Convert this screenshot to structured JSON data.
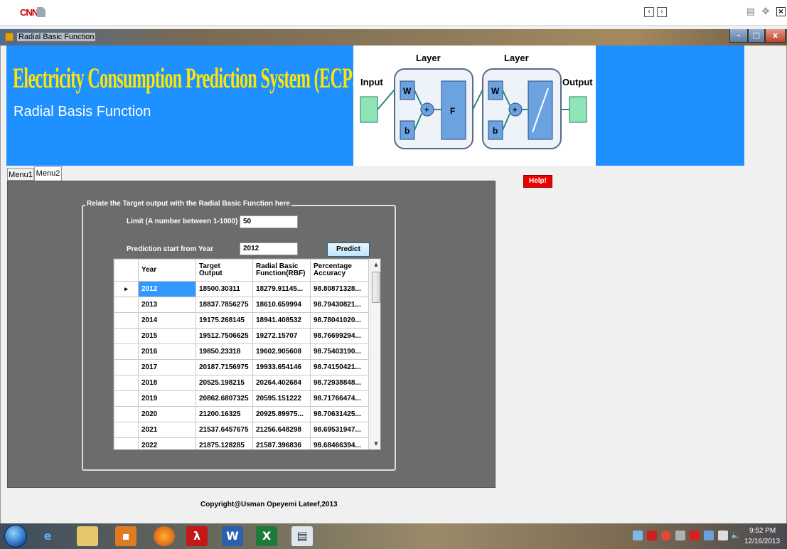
{
  "browser": {
    "logo_text": "CNN",
    "prev_glyph": "‹",
    "next_glyph": "›"
  },
  "window": {
    "title": "Radial Basic Function",
    "min_glyph": "–",
    "max_glyph": "□",
    "close_glyph": "x"
  },
  "banner": {
    "title": "Electricity Consumption Prediction System (ECPS)",
    "subtitle": "Radial Basis Function",
    "diagram": {
      "input_label": "Input",
      "output_label": "Output",
      "layer1_label": "Layer",
      "layer2_label": "Layer",
      "w": "W",
      "b": "b",
      "plus": "+",
      "f": "F"
    }
  },
  "help_button": "Help!",
  "tabs": [
    {
      "label": "Menu1",
      "active": false
    },
    {
      "label": "Menu2",
      "active": true
    }
  ],
  "form": {
    "group_title": "Relate the Target output with the Radial Basic Function here",
    "limit_label": "Limit (A number between 1-1000)",
    "limit_value": "50",
    "start_year_label": "Prediction start from Year",
    "start_year_value": "2012",
    "predict_button": "Predict"
  },
  "grid": {
    "columns": [
      "Year",
      "Target Output",
      "Radial Basic Function(RBF)",
      "Percentage Accuracy"
    ],
    "rows": [
      [
        "2012",
        "18500.30311",
        "18279.91145...",
        "98.80871328..."
      ],
      [
        "2013",
        "18837.7856275",
        "18610.659994",
        "98.79430821..."
      ],
      [
        "2014",
        "19175.268145",
        "18941.408532",
        "98.78041020..."
      ],
      [
        "2015",
        "19512.7506625",
        "19272.15707",
        "98.76699294..."
      ],
      [
        "2016",
        "19850.23318",
        "19602.905608",
        "98.75403190..."
      ],
      [
        "2017",
        "20187.7156975",
        "19933.654146",
        "98.74150421..."
      ],
      [
        "2018",
        "20525.198215",
        "20264.402684",
        "98.72938848..."
      ],
      [
        "2019",
        "20862.6807325",
        "20595.151222",
        "98.71766474..."
      ],
      [
        "2020",
        "21200.16325",
        "20925.89975...",
        "98.70631425..."
      ],
      [
        "2021",
        "21537.6457675",
        "21256.648298",
        "98.69531947..."
      ],
      [
        "2022",
        "21875.128285",
        "21587.396836",
        "98.68466394..."
      ]
    ],
    "selected_row": 0,
    "row_indicator": "▸"
  },
  "footer": {
    "copyright": "Copyright@Usman Opeyemi Lateef,2013"
  },
  "taskbar": {
    "time": "9:52 PM",
    "date": "12/16/2013"
  },
  "colors": {
    "banner_bg": "#1e90ff",
    "title_yellow": "#ffe600",
    "panel_gray": "#6c6c6c",
    "help_red": "#ee0000",
    "selection_blue": "#3399ff"
  }
}
